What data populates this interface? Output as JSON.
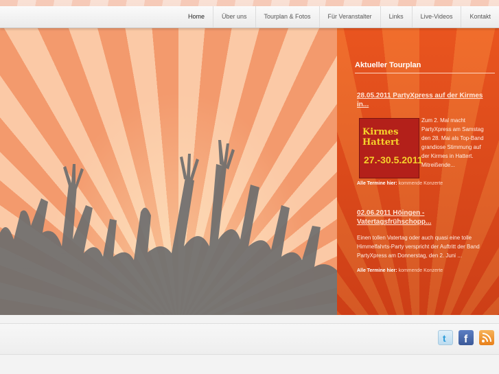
{
  "nav": {
    "items": [
      "Home",
      "Über uns",
      "Tourplan & Fotos",
      "Für Veranstalter",
      "Links",
      "Live-Videos",
      "Kontakt"
    ]
  },
  "sidebar": {
    "title": "Aktueller Tourplan",
    "posts": [
      {
        "title": "28.05.2011 PartyXpress auf der Kirmes in...",
        "image_text_top": "Kirmes Hattert",
        "image_text_bottom": "27.-30.5.2011",
        "text_lines": [
          "Zum 2. Mal macht",
          "PartyXpress am Samstag",
          "den 28. Mai als Top-Band",
          "grandiose Stimmung auf",
          "der Kirmes in Hattert.",
          "Mitreißende..."
        ],
        "more_label": "Alle Termine hier:",
        "more_link": "kommende Konzerte"
      },
      {
        "title": "02.06.2011 Höingen - Vatertagsfrühschopp...",
        "text_lines": [
          "Einen tollen Vatertag oder auch quasi eine tolle",
          "Himmelfahrts-Party verspricht der Auftritt der Band",
          "PartyXpress am Donnerstag, den 2. Juni ..."
        ],
        "more_label": "Alle Termine hier:",
        "more_link": "kommende Konzerte"
      }
    ]
  },
  "colors": {
    "accent": "#e2491c",
    "hero_ray_light": "#fbc9a6",
    "hero_ray_dark": "#f39a6d",
    "crowd": "#6e6e6e"
  },
  "footer": {
    "icons": [
      "twitter-icon",
      "facebook-icon",
      "rss-icon"
    ]
  }
}
